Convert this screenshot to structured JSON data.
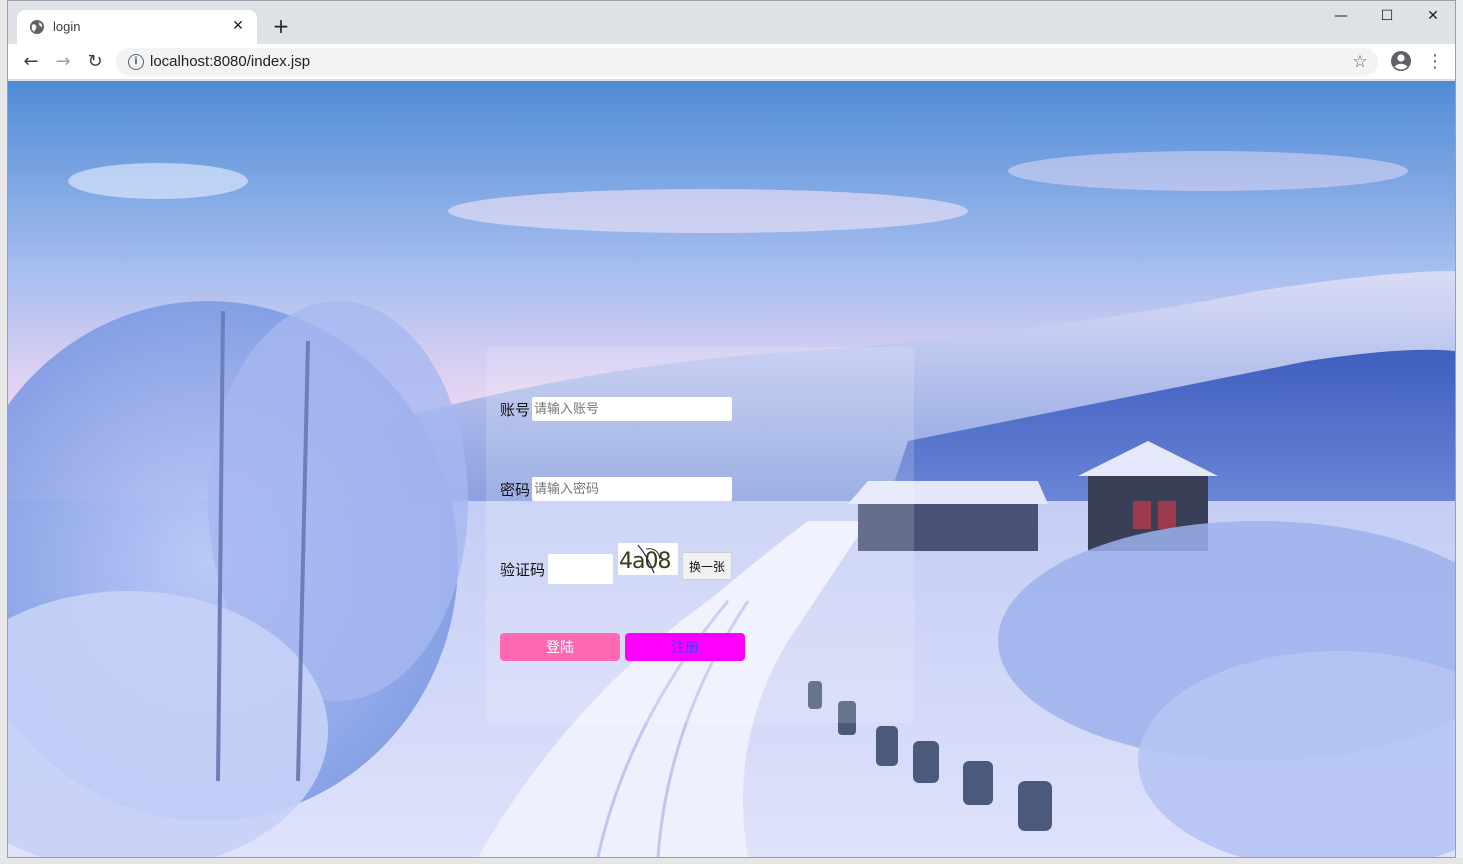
{
  "browser": {
    "tab_title": "login",
    "tab_close": "✕",
    "new_tab": "+",
    "url": "localhost:8080/index.jsp",
    "window_controls": {
      "minimize": "—",
      "maximize": "☐",
      "close": "✕"
    },
    "nav": {
      "back": "←",
      "forward": "→",
      "reload": "↻",
      "star": "☆",
      "menu": "⋮",
      "info": "i"
    }
  },
  "login": {
    "account_label": "账号",
    "account_placeholder": "请输入账号",
    "password_label": "密码",
    "password_placeholder": "请输入密码",
    "captcha_label": "验证码",
    "captcha_value": "",
    "captcha_text": "4a08",
    "swap_label": "换一张",
    "login_label": "登陆",
    "register_label": "注册"
  },
  "colors": {
    "login_button": "#ff69b4",
    "register_button": "#ff00ff",
    "register_text": "#3f3fff"
  },
  "icons": [
    "globe-icon",
    "close-icon",
    "plus-icon",
    "back-arrow-icon",
    "forward-arrow-icon",
    "reload-icon",
    "info-icon",
    "star-icon",
    "account-icon",
    "kebab-menu-icon"
  ]
}
